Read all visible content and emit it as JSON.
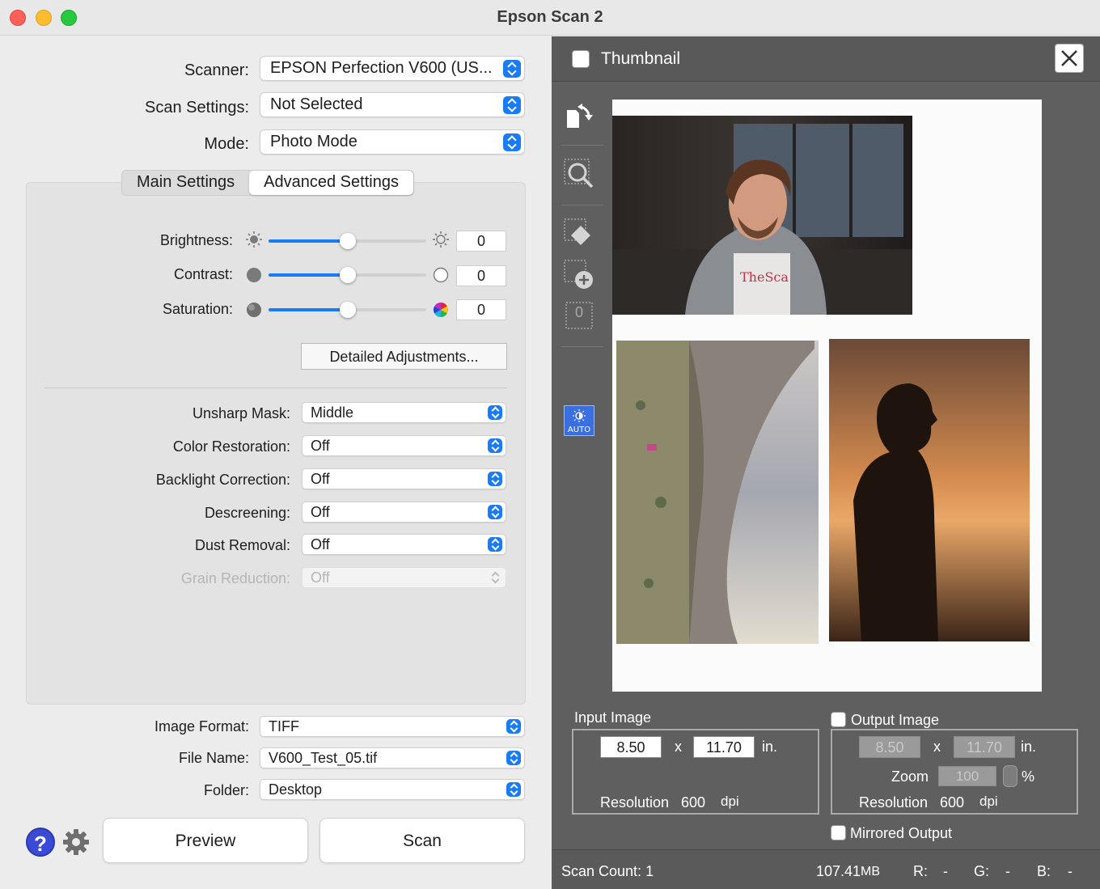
{
  "window": {
    "title": "Epson Scan 2"
  },
  "scanner": {
    "label": "Scanner:",
    "value": "EPSON Perfection V600 (US..."
  },
  "scan_settings": {
    "label": "Scan Settings:",
    "value": "Not Selected"
  },
  "mode": {
    "label": "Mode:",
    "value": "Photo Mode"
  },
  "tabs": [
    {
      "label": "Main Settings",
      "active": false
    },
    {
      "label": "Advanced Settings",
      "active": true
    }
  ],
  "adjustments": {
    "brightness": {
      "label": "Brightness:",
      "value": "0",
      "level": 0.5
    },
    "contrast": {
      "label": "Contrast:",
      "value": "0",
      "level": 0.5
    },
    "saturation": {
      "label": "Saturation:",
      "value": "0",
      "level": 0.5
    },
    "detailed_button": "Detailed Adjustments..."
  },
  "advanced": {
    "unsharp_mask": {
      "label": "Unsharp Mask:",
      "value": "Middle"
    },
    "color_restoration": {
      "label": "Color Restoration:",
      "value": "Off"
    },
    "backlight_correction": {
      "label": "Backlight Correction:",
      "value": "Off"
    },
    "descreening": {
      "label": "Descreening:",
      "value": "Off"
    },
    "dust_removal": {
      "label": "Dust Removal:",
      "value": "Off"
    },
    "grain_reduction": {
      "label": "Grain Reduction:",
      "value": "Off",
      "disabled": true
    }
  },
  "output": {
    "image_format": {
      "label": "Image Format:",
      "value": "TIFF"
    },
    "file_name": {
      "label": "File Name:",
      "value": "V600_Test_05.tif"
    },
    "folder": {
      "label": "Folder:",
      "value": "Desktop"
    }
  },
  "buttons": {
    "help": "?",
    "preview": "Preview",
    "scan": "Scan"
  },
  "thumbnail": {
    "label": "Thumbnail",
    "checked": false
  },
  "tools": {
    "auto_label": "AUTO",
    "counter": "0"
  },
  "input_image": {
    "title": "Input Image",
    "width": "8.50",
    "x": "x",
    "height": "11.70",
    "unit": "in.",
    "resolution_label": "Resolution",
    "resolution": "600",
    "resolution_unit": "dpi"
  },
  "output_image": {
    "title": "Output Image",
    "checked": false,
    "width": "8.50",
    "x": "x",
    "height": "11.70",
    "unit": "in.",
    "zoom_label": "Zoom",
    "zoom": "100",
    "zoom_unit": "%",
    "resolution_label": "Resolution",
    "resolution": "600",
    "resolution_unit": "dpi"
  },
  "mirrored_output": {
    "label": "Mirrored Output",
    "checked": false
  },
  "status": {
    "scan_count": "Scan Count: 1",
    "size": "107.41",
    "size_unit": "MB",
    "r_label": "R:",
    "r_value": "-",
    "g_label": "G:",
    "g_value": "-",
    "b_label": "B:",
    "b_value": "-"
  },
  "colors": {
    "accent": "#1a7cf5",
    "panel_dark": "#5f5f5f",
    "auto_button": "#3a6fe0"
  }
}
